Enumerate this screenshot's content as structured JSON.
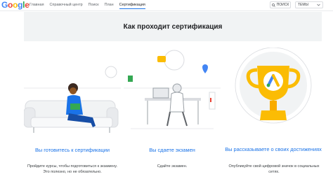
{
  "brand": {
    "logo_letters": [
      "G",
      "o",
      "o",
      "g",
      "l",
      "e"
    ],
    "logo_colors": [
      "#4285F4",
      "#EA4335",
      "#FBBC05",
      "#4285F4",
      "#34A853",
      "#EA4335"
    ]
  },
  "nav": {
    "items": [
      {
        "label": "Главная",
        "active": false
      },
      {
        "label": "Справочный центр",
        "active": false
      },
      {
        "label": "Поиск",
        "active": false
      },
      {
        "label": "План",
        "active": false
      },
      {
        "label": "Сертификация",
        "active": true
      }
    ]
  },
  "toolbar": {
    "search_label": "ПОИСК",
    "topics_label": "ТЕМЫ",
    "search_icon": "search-icon",
    "topics_icon": "chevron-down-icon"
  },
  "hero": {
    "title": "Как проходит сертификация"
  },
  "steps": [
    {
      "title": "Вы готовитесь к сертификации",
      "description": "Пройдите курсы, чтобы подготовиться к экзамену. Это полезно, но не обязательно."
    },
    {
      "title": "Вы сдаете экзамен",
      "description": "Сдайте экзамен."
    },
    {
      "title": "Вы рассказываете о своих достижениях",
      "description": "Опубликуйте свой цифровой значок в социальных сетях."
    }
  ],
  "colors": {
    "accent": "#1a73e8",
    "trophy": "#fbbc04",
    "hero_bg": "#f1f3f4"
  }
}
